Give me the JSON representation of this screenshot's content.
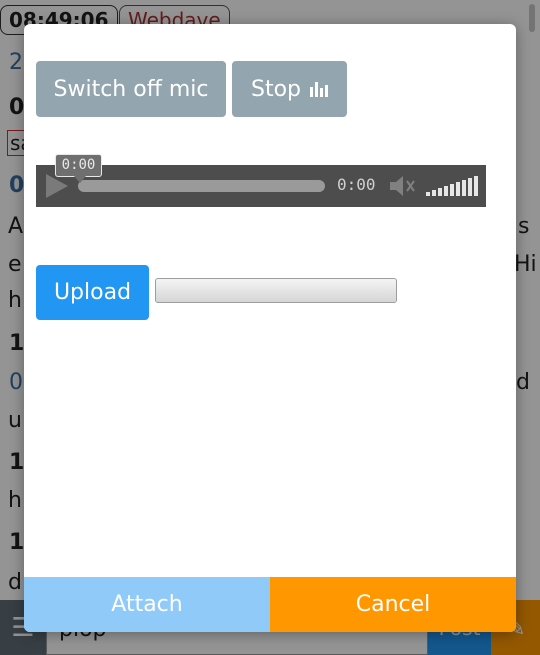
{
  "background": {
    "time_label": "08:49:06",
    "nick_label": "Webdave",
    "date_fragment": "2",
    "row_texts": [
      "0",
      "sa",
      "0",
      "A",
      "s",
      "e",
      "Hi",
      "h",
      "1",
      "0",
      "d",
      "u",
      "1",
      "h",
      "1",
      "d"
    ],
    "message_input_value": "plop",
    "post_label": "Post"
  },
  "dialog": {
    "mic_button_label": "Switch off mic",
    "stop_button_label": "Stop",
    "audio_player": {
      "time_display": "0:00",
      "seek_tooltip": "0:00",
      "volume_level": 1.0
    },
    "upload_button_label": "Upload",
    "upload_progress": 0,
    "attach_label": "Attach",
    "cancel_label": "Cancel"
  }
}
